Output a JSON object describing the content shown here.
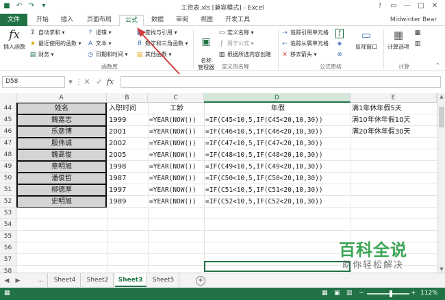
{
  "window": {
    "title": "工资表.xls  [兼容模式] - Excel",
    "controls": [
      "?",
      "▭",
      "—",
      "□",
      "✕"
    ]
  },
  "quick_access": [
    "save-icon",
    "undo-icon",
    "redo-icon",
    "customize-icon"
  ],
  "tabs": [
    "文件",
    "开始",
    "插入",
    "页面布局",
    "公式",
    "数据",
    "审阅",
    "视图",
    "开发工具"
  ],
  "active_tab": "公式",
  "user": "Midwinter Bear",
  "ribbon": {
    "library": {
      "insert_function": "插入函数",
      "items": [
        "自动求和",
        "最近使用的函数",
        "财务",
        "逻辑",
        "文本",
        "日期和时间",
        "查找与引用",
        "数学和三角函数",
        "其他函数"
      ],
      "label": "函数库"
    },
    "names": {
      "name_manager": "名称\n管理器",
      "items": [
        "定义名称",
        "用于公式",
        "根据所选内容创建"
      ],
      "label": "定义的名称"
    },
    "audit": {
      "items": [
        "追踪引用单元格",
        "追踪从属单元格",
        "移去箭头"
      ],
      "watch_window": "监视窗口",
      "label": "公式审核"
    },
    "calc": {
      "calc_options": "计算选项",
      "label": "计算"
    }
  },
  "formula_bar": {
    "name_box": "D58",
    "fx": "fx",
    "value": ""
  },
  "columns": [
    "A",
    "B",
    "C",
    "D",
    "E"
  ],
  "rows": [
    {
      "n": "44",
      "a": "姓名",
      "b": "入职时间",
      "c": "工龄",
      "d": "年假",
      "e": "满1年休年假5天"
    },
    {
      "n": "45",
      "a": "魏嘉志",
      "b": "1999",
      "c": "=YEAR(NOW())",
      "d": "=IF(C45<10,5,IF(C45<20,10,30))",
      "e": "满10年休年假10天"
    },
    {
      "n": "46",
      "a": "乐彦博",
      "b": "2001",
      "c": "=YEAR(NOW())",
      "d": "=IF(C46<10,5,IF(C46<20,10,30))",
      "e": "满20年休年假30天"
    },
    {
      "n": "47",
      "a": "殷伟诚",
      "b": "2002",
      "c": "=YEAR(NOW())",
      "d": "=IF(C47<10,5,IF(C47<20,10,30))",
      "e": ""
    },
    {
      "n": "48",
      "a": "魏高俊",
      "b": "2005",
      "c": "=YEAR(NOW())",
      "d": "=IF(C48<10,5,IF(C48<20,10,30))",
      "e": ""
    },
    {
      "n": "49",
      "a": "章明旭",
      "b": "1998",
      "c": "=YEAR(NOW())",
      "d": "=IF(C49<10,5,IF(C49<20,10,30))",
      "e": ""
    },
    {
      "n": "50",
      "a": "潘俊哲",
      "b": "1987",
      "c": "=YEAR(NOW())",
      "d": "=IF(C50<10,5,IF(C50<20,10,30))",
      "e": ""
    },
    {
      "n": "51",
      "a": "柳德厚",
      "b": "1997",
      "c": "=YEAR(NOW())",
      "d": "=IF(C51<10,5,IF(C51<20,10,30))",
      "e": ""
    },
    {
      "n": "52",
      "a": "史明旭",
      "b": "1989",
      "c": "=YEAR(NOW())",
      "d": "=IF(C52<10,5,IF(C52<20,10,30))",
      "e": ""
    },
    {
      "n": "53",
      "a": "",
      "b": "",
      "c": "",
      "d": "",
      "e": ""
    },
    {
      "n": "54",
      "a": "",
      "b": "",
      "c": "",
      "d": "",
      "e": ""
    },
    {
      "n": "55",
      "a": "",
      "b": "",
      "c": "",
      "d": "",
      "e": ""
    },
    {
      "n": "56",
      "a": "",
      "b": "",
      "c": "",
      "d": "",
      "e": ""
    },
    {
      "n": "57",
      "a": "",
      "b": "",
      "c": "",
      "d": "",
      "e": ""
    },
    {
      "n": "58",
      "a": "",
      "b": "",
      "c": "",
      "d": "",
      "e": ""
    }
  ],
  "sheets": [
    "...",
    "Sheet4",
    "Sheet2",
    "Sheet3",
    "Sheet5"
  ],
  "active_sheet": "Sheet3",
  "status": {
    "zoom": "112%",
    "zoom_fraction": 0.56
  },
  "watermark": {
    "main": "百科全说",
    "sub": "助你轻松解决"
  },
  "colors": {
    "excel_green": "#217346",
    "arrow": "#d04040",
    "watermark": "#3aa655"
  }
}
